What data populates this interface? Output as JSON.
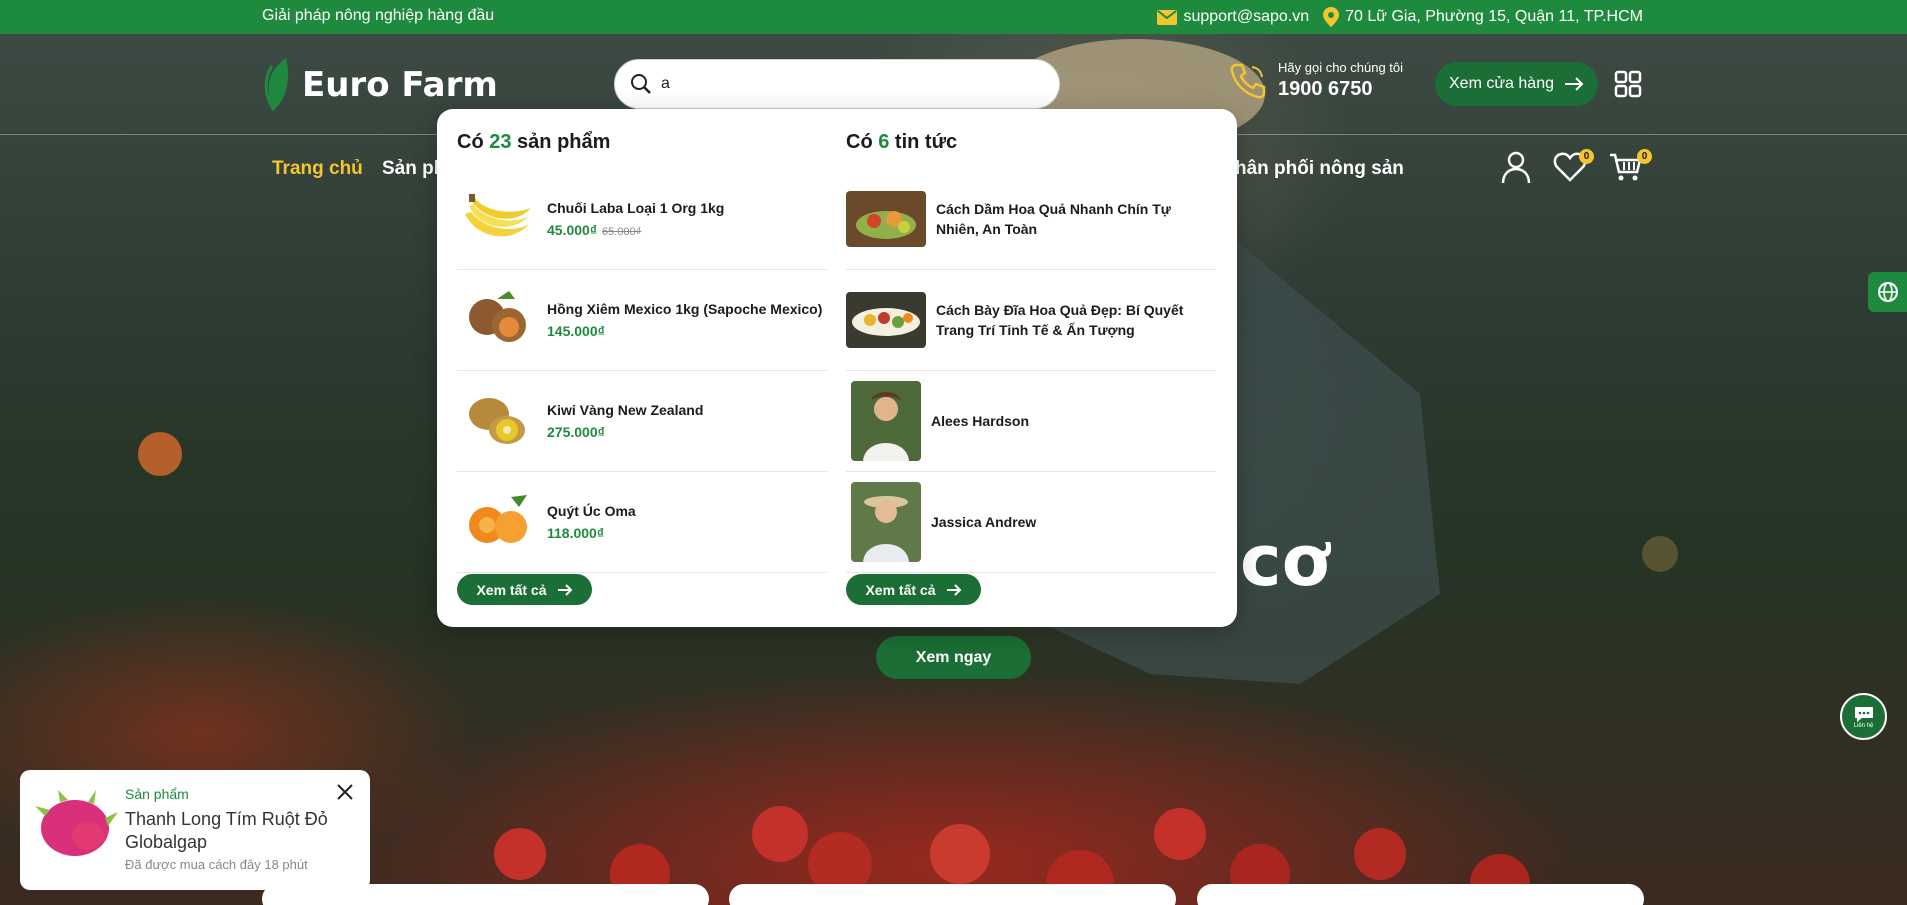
{
  "topbar": {
    "tagline": "Giải pháp nông nghiệp hàng đầu",
    "email": "support@sapo.vn",
    "address": "70 Lữ Gia, Phường 15, Quận 11, TP.HCM"
  },
  "header": {
    "logo_text": "Euro Farm",
    "search_value": "a",
    "hotline_label": "Hãy gọi cho chúng tôi",
    "hotline_number": "1900 6750",
    "store_button": "Xem cửa hàng"
  },
  "nav": {
    "home": "Trang chủ",
    "products_partial": "Sản ph",
    "distribution_partial": "hân phối nông sản",
    "wishlist_count": "0",
    "cart_count": "0"
  },
  "dropdown": {
    "products_prefix": "Có",
    "products_count": "23",
    "products_suffix": "sản phẩm",
    "news_prefix": "Có",
    "news_count": "6",
    "news_suffix": "tin tức",
    "products": [
      {
        "title": "Chuối Laba Loại 1 Org 1kg",
        "price": "45.000₫",
        "old_price": "65.000₫"
      },
      {
        "title": "Hồng Xiêm Mexico 1kg (Sapoche Mexico)",
        "price": "145.000₫",
        "old_price": ""
      },
      {
        "title": "Kiwi Vàng New Zealand",
        "price": "275.000₫",
        "old_price": ""
      },
      {
        "title": "Quýt Úc Oma",
        "price": "118.000₫",
        "old_price": ""
      }
    ],
    "news": [
      {
        "title": "Cách Dầm Hoa Quả Nhanh Chín Tự Nhiên, An Toàn"
      },
      {
        "title": "Cách Bày Đĩa Hoa Quả Đẹp: Bí Quyết Trang Trí Tinh Tế & Ấn Tượng"
      },
      {
        "title": "Alees Hardson"
      },
      {
        "title": "Jassica Andrew"
      }
    ],
    "see_all_products": "Xem tất cả",
    "see_all_news": "Xem tất cả"
  },
  "hero": {
    "word": "cơ",
    "cta": "Xem ngay"
  },
  "chat": {
    "label": "Liên hệ"
  },
  "popup": {
    "category": "Sản phẩm",
    "name": "Thanh Long Tím Ruột Đỏ Globalgap",
    "time": "Đã được mua cách đây 18 phút"
  },
  "colors": {
    "brand_green": "#1e8a3e",
    "dark_green": "#1b6e35",
    "accent_yellow": "#f4c531"
  }
}
